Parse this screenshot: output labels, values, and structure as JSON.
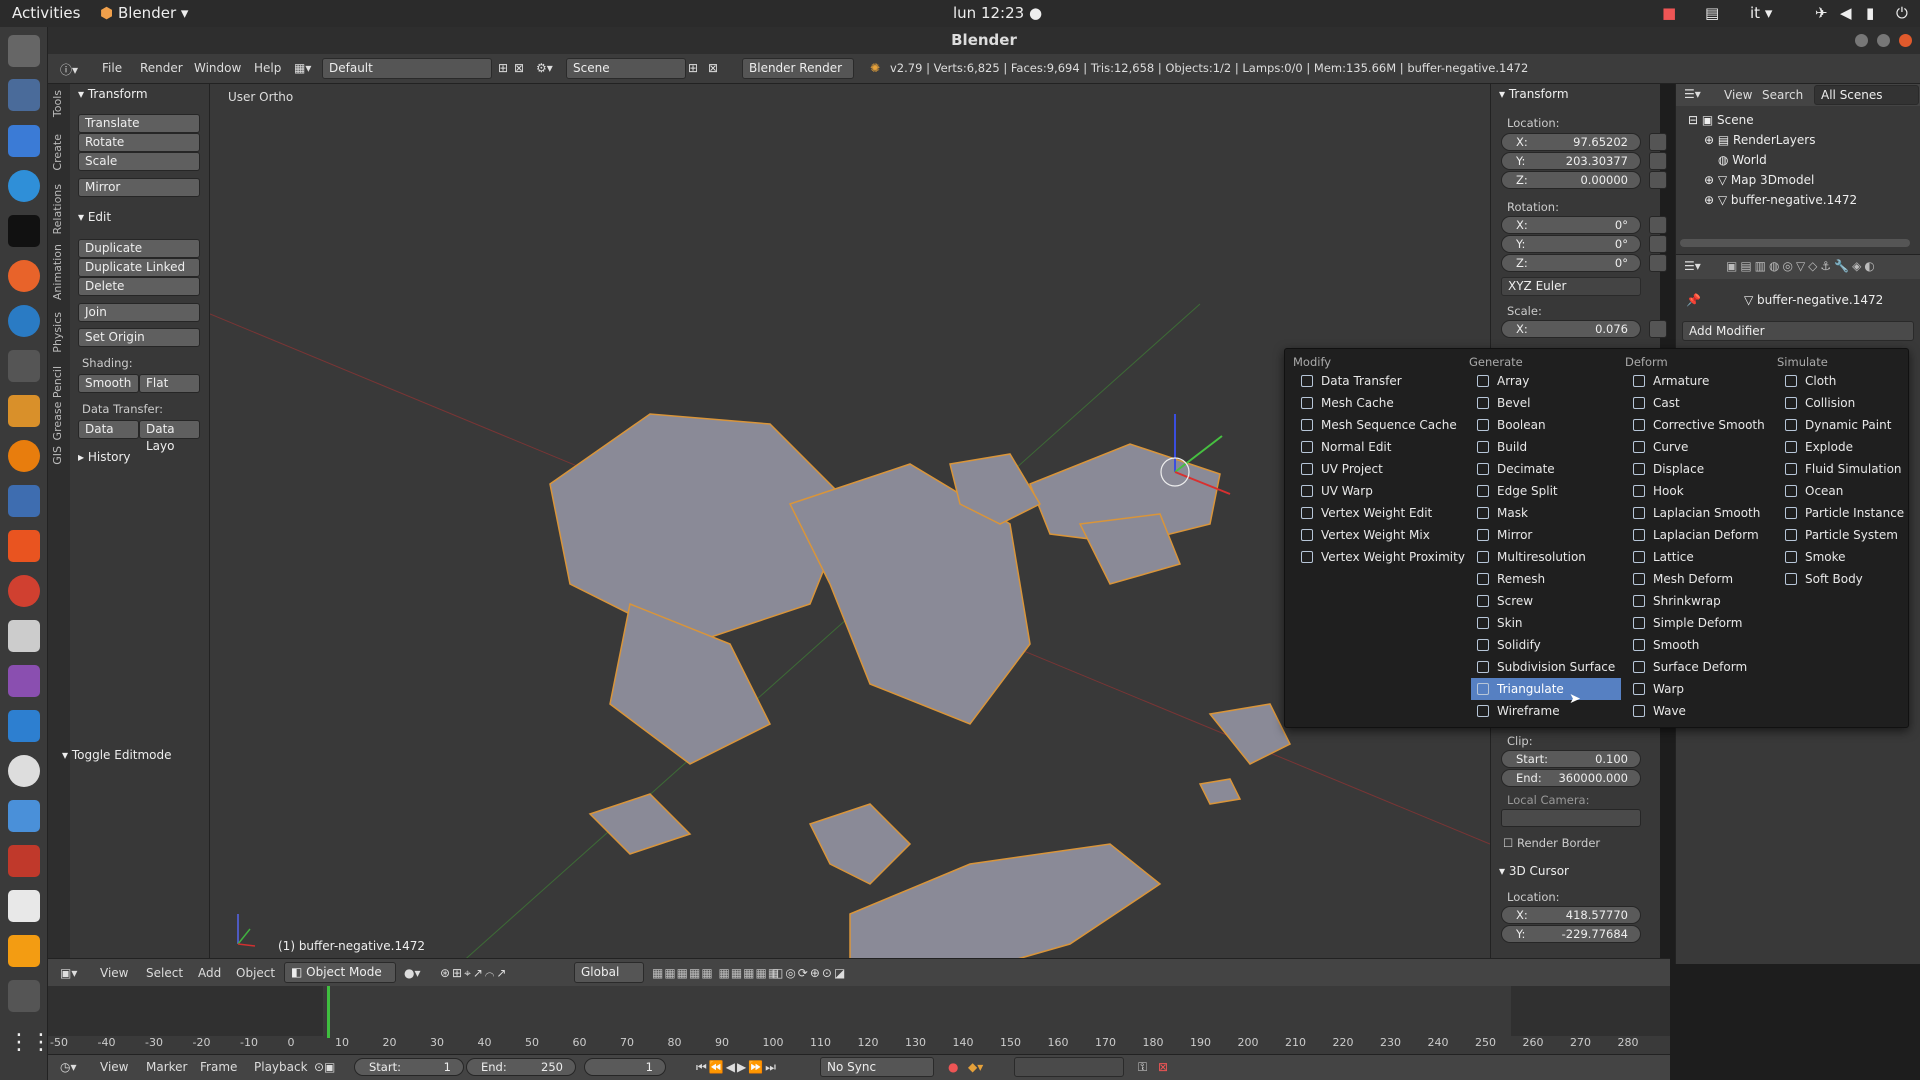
{
  "topbar": {
    "activities": "Activities",
    "app": "Blender ▾",
    "clock": "lun 12:23 ●",
    "lang": "it ▾"
  },
  "window": {
    "title": "Blender"
  },
  "info": {
    "menus": [
      "File",
      "Render",
      "Window",
      "Help"
    ],
    "layout": "Default",
    "scene": "Scene",
    "engine": "Blender Render",
    "stats": "v2.79 | Verts:6,825 | Faces:9,694 | Tris:12,658 | Objects:1/2 | Lamps:0/0 | Mem:135.66M | buffer-negative.1472"
  },
  "vtabs": [
    "Tools",
    "Create",
    "Relations",
    "Animation",
    "Physics",
    "Grease Pencil",
    "GIS"
  ],
  "toolshelf": {
    "transform_header": "Transform",
    "translate": "Translate",
    "rotate": "Rotate",
    "scale": "Scale",
    "mirror": "Mirror",
    "edit_header": "Edit",
    "duplicate": "Duplicate",
    "duplicate_linked": "Duplicate Linked",
    "delete": "Delete",
    "join": "Join",
    "set_origin": "Set Origin",
    "shading_label": "Shading:",
    "smooth": "Smooth",
    "flat": "Flat",
    "data_transfer_label": "Data Transfer:",
    "data": "Data",
    "data_layo": "Data Layo",
    "history_header": "History",
    "toggle_editmode": "Toggle Editmode"
  },
  "viewport": {
    "view_label": "User Ortho",
    "object_label": "(1) buffer-negative.1472"
  },
  "npanel": {
    "transform_header": "Transform",
    "location_label": "Location:",
    "loc_x": "97.65202",
    "loc_y": "203.30377",
    "loc_z": "0.00000",
    "rotation_label": "Rotation:",
    "rot_x": "0°",
    "rot_y": "0°",
    "rot_z": "0°",
    "rot_mode": "XYZ Euler",
    "scale_label": "Scale:",
    "scale_x": "0.076",
    "clip_label": "Clip:",
    "clip_start": "0.100",
    "clip_end": "360000.000",
    "local_camera_label": "Local Camera:",
    "render_border": "Render Border",
    "cursor_header": "3D Cursor",
    "cursor_location_label": "Location:",
    "cursor_x": "418.57770",
    "cursor_y": "-229.77684"
  },
  "outliner": {
    "view": "View",
    "search": "Search",
    "scenes": "All Scenes",
    "items": [
      "Scene",
      "RenderLayers",
      "World",
      "Map 3Dmodel",
      "buffer-negative.1472"
    ]
  },
  "properties": {
    "object_name": "buffer-negative.1472",
    "add_modifier": "Add Modifier"
  },
  "menu": {
    "headers": [
      "Modify",
      "Generate",
      "Deform",
      "Simulate"
    ],
    "modify": [
      "Data Transfer",
      "Mesh Cache",
      "Mesh Sequence Cache",
      "Normal Edit",
      "UV Project",
      "UV Warp",
      "Vertex Weight Edit",
      "Vertex Weight Mix",
      "Vertex Weight Proximity"
    ],
    "generate": [
      "Array",
      "Bevel",
      "Boolean",
      "Build",
      "Decimate",
      "Edge Split",
      "Mask",
      "Mirror",
      "Multiresolution",
      "Remesh",
      "Screw",
      "Skin",
      "Solidify",
      "Subdivision Surface",
      "Triangulate",
      "Wireframe"
    ],
    "deform": [
      "Armature",
      "Cast",
      "Corrective Smooth",
      "Curve",
      "Displace",
      "Hook",
      "Laplacian Smooth",
      "Laplacian Deform",
      "Lattice",
      "Mesh Deform",
      "Shrinkwrap",
      "Simple Deform",
      "Smooth",
      "Surface Deform",
      "Warp",
      "Wave"
    ],
    "simulate": [
      "Cloth",
      "Collision",
      "Dynamic Paint",
      "Explode",
      "Fluid Simulation",
      "Ocean",
      "Particle Instance",
      "Particle System",
      "Smoke",
      "Soft Body"
    ],
    "selected": "Triangulate"
  },
  "vpheader": {
    "view": "View",
    "select": "Select",
    "add": "Add",
    "object": "Object",
    "mode": "Object Mode",
    "orientation": "Global"
  },
  "timeline": {
    "ticks": [
      "-50",
      "-40",
      "-30",
      "-20",
      "-10",
      "0",
      "10",
      "20",
      "30",
      "40",
      "50",
      "60",
      "70",
      "80",
      "90",
      "100",
      "110",
      "120",
      "130",
      "140",
      "150",
      "160",
      "170",
      "180",
      "190",
      "200",
      "210",
      "220",
      "230",
      "240",
      "250",
      "260",
      "270",
      "280"
    ],
    "view": "View",
    "marker": "Marker",
    "frame": "Frame",
    "playback": "Playback",
    "start": "Start:",
    "start_val": "1",
    "end": "End:",
    "end_val": "250",
    "current": "1",
    "sync": "No Sync"
  },
  "colors": {
    "accent": "#5680c2",
    "menu_bg": "#1f1f1f",
    "viewport_bg": "#393939"
  }
}
